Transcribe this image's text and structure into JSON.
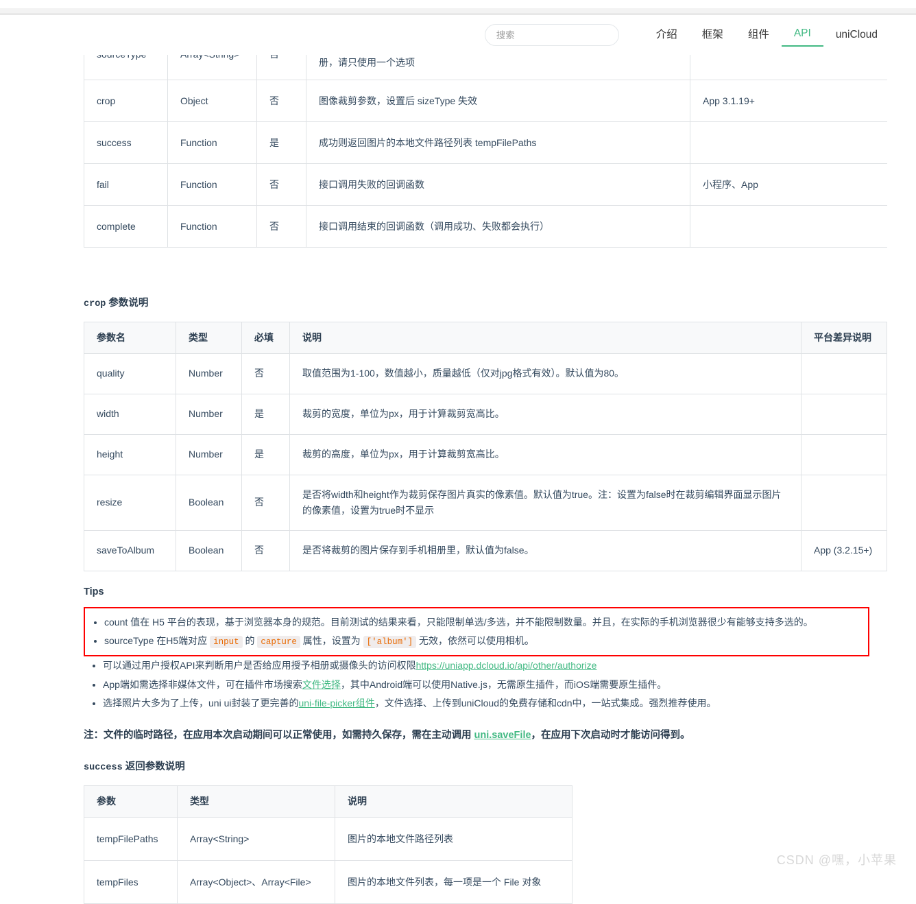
{
  "header": {
    "search": {
      "placeholder": "搜索",
      "value": ""
    },
    "nav": [
      {
        "label": "介绍",
        "active": false
      },
      {
        "label": "框架",
        "active": false
      },
      {
        "label": "组件",
        "active": false
      },
      {
        "label": "API",
        "active": true
      },
      {
        "label": "uniCloud",
        "active": false
      }
    ]
  },
  "main_table": {
    "columns": [
      "参数名",
      "类型",
      "必填",
      "说明",
      "平台差异说明"
    ],
    "rows": [
      {
        "name": "sourceType",
        "type": "Array<String>",
        "required": "否",
        "desc": "album 从相册选图，camera 使用相机，默认二者都有。如需直接开相机或直接选相册，请只使用一个选项",
        "platform": ""
      },
      {
        "name": "crop",
        "type": "Object",
        "required": "否",
        "desc": "图像裁剪参数，设置后 sizeType 失效",
        "platform": "App 3.1.19+"
      },
      {
        "name": "success",
        "type": "Function",
        "required": "是",
        "desc": "成功则返回图片的本地文件路径列表 tempFilePaths",
        "platform": ""
      },
      {
        "name": "fail",
        "type": "Function",
        "required": "否",
        "desc": "接口调用失败的回调函数",
        "platform": "小程序、App"
      },
      {
        "name": "complete",
        "type": "Function",
        "required": "否",
        "desc": "接口调用结束的回调函数（调用成功、失败都会执行）",
        "platform": ""
      }
    ]
  },
  "crop_section": {
    "title_code": "crop",
    "title_text": " 参数说明",
    "columns": [
      "参数名",
      "类型",
      "必填",
      "说明",
      "平台差异说明"
    ],
    "rows": [
      {
        "name": "quality",
        "type": "Number",
        "required": "否",
        "desc": "取值范围为1-100，数值越小，质量越低（仅对jpg格式有效）。默认值为80。",
        "platform": ""
      },
      {
        "name": "width",
        "type": "Number",
        "required": "是",
        "desc": "裁剪的宽度，单位为px，用于计算裁剪宽高比。",
        "platform": ""
      },
      {
        "name": "height",
        "type": "Number",
        "required": "是",
        "desc": "裁剪的高度，单位为px，用于计算裁剪宽高比。",
        "platform": ""
      },
      {
        "name": "resize",
        "type": "Boolean",
        "required": "否",
        "desc": "是否将width和height作为裁剪保存图片真实的像素值。默认值为true。注：设置为false时在裁剪编辑界面显示图片的像素值，设置为true时不显示",
        "platform": ""
      },
      {
        "name": "saveToAlbum",
        "type": "Boolean",
        "required": "否",
        "desc": "是否将裁剪的图片保存到手机相册里，默认值为false。",
        "platform": "App (3.2.15+)"
      }
    ]
  },
  "tips": {
    "title": "Tips",
    "highlighted": [
      {
        "parts": [
          {
            "t": "text",
            "v": "count 值在 H5 平台的表现，基于浏览器本身的规范。目前测试的结果来看，只能限制单选/多选，并不能限制数量。并且，在实际的手机浏览器很少有能够支持多选的。"
          }
        ]
      },
      {
        "parts": [
          {
            "t": "text",
            "v": "sourceType 在H5端对应 "
          },
          {
            "t": "code",
            "v": "input"
          },
          {
            "t": "text",
            "v": " 的 "
          },
          {
            "t": "code",
            "v": "capture"
          },
          {
            "t": "text",
            "v": " 属性，设置为 "
          },
          {
            "t": "code",
            "v": "['album']"
          },
          {
            "t": "text",
            "v": " 无效，依然可以使用相机。"
          }
        ]
      }
    ],
    "others": [
      {
        "parts": [
          {
            "t": "text",
            "v": "可以通过用户授权API来判断用户是否给应用授予相册或摄像头的访问权限"
          },
          {
            "t": "link",
            "v": "https://uniapp.dcloud.io/api/other/authorize"
          }
        ]
      },
      {
        "parts": [
          {
            "t": "text",
            "v": "App端如需选择非媒体文件，可在插件市场搜索"
          },
          {
            "t": "link",
            "v": "文件选择"
          },
          {
            "t": "text",
            "v": "，其中Android端可以使用Native.js，无需原生插件，而iOS端需要原生插件。"
          }
        ]
      },
      {
        "parts": [
          {
            "t": "text",
            "v": "选择照片大多为了上传，uni ui封装了更完善的"
          },
          {
            "t": "link",
            "v": "uni-file-picker组件"
          },
          {
            "t": "text",
            "v": "，文件选择、上传到uniCloud的免费存储和cdn中，一站式集成。强烈推荐使用。"
          }
        ]
      }
    ]
  },
  "note": {
    "before": "注：文件的临时路径，在应用本次启动期间可以正常使用，如需持久保存，需在主动调用 ",
    "link": "uni.saveFile",
    "after": "，在应用下次启动时才能访问得到。"
  },
  "success_section": {
    "title_code": "success",
    "title_text": " 返回参数说明",
    "columns": [
      "参数",
      "类型",
      "说明"
    ],
    "rows": [
      {
        "name": "tempFilePaths",
        "type": "Array<String>",
        "desc": "图片的本地文件路径列表"
      },
      {
        "name": "tempFiles",
        "type": "Array<Object>、Array<File>",
        "desc": "图片的本地文件列表，每一项是一个 File 对象"
      }
    ]
  },
  "watermark": "CSDN @嘿，小苹果",
  "colors": {
    "accent": "#42b983",
    "highlight_border": "#fe0000",
    "code_text": "#e96900",
    "code_bg": "#f0ecec",
    "table_border": "#dfe2e5",
    "table_header_bg": "#f8f9fa",
    "text": "#34495e"
  }
}
